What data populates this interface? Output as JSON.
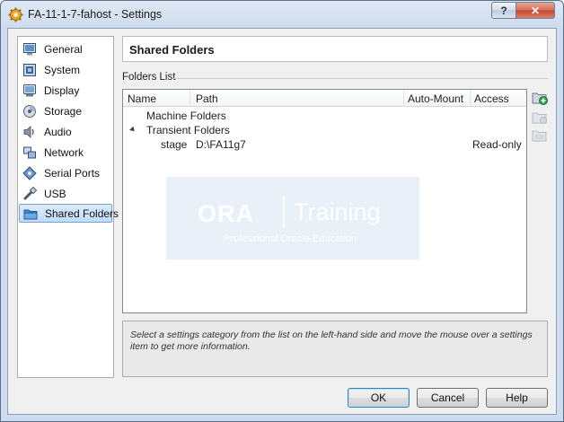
{
  "window": {
    "title": "FA-11-1-7-fahost - Settings",
    "help_label": "?",
    "close_label": "✕"
  },
  "sidebar": {
    "items": [
      {
        "label": "General",
        "icon": "general-icon"
      },
      {
        "label": "System",
        "icon": "system-icon"
      },
      {
        "label": "Display",
        "icon": "display-icon"
      },
      {
        "label": "Storage",
        "icon": "storage-icon"
      },
      {
        "label": "Audio",
        "icon": "audio-icon"
      },
      {
        "label": "Network",
        "icon": "network-icon"
      },
      {
        "label": "Serial Ports",
        "icon": "serial-ports-icon"
      },
      {
        "label": "USB",
        "icon": "usb-icon"
      },
      {
        "label": "Shared Folders",
        "icon": "shared-folders-icon",
        "selected": true
      }
    ]
  },
  "page": {
    "title": "Shared Folders",
    "group_label": "Folders List"
  },
  "folders_table": {
    "columns": [
      "Name",
      "Path",
      "Auto-Mount",
      "Access"
    ],
    "groups": [
      {
        "name": "Machine Folders",
        "rows": []
      },
      {
        "name": "Transient Folders",
        "rows": [
          {
            "name": "stage",
            "path": "D:\\FA11g7",
            "auto_mount": "",
            "access": "Read-only"
          }
        ]
      }
    ]
  },
  "watermark": {
    "logo": "ORA",
    "name": "Training",
    "tagline": "Professional Oracle Education"
  },
  "toolbar": {
    "add_icon": "add-folder-icon",
    "edit_icon": "edit-folder-icon",
    "remove_icon": "remove-folder-icon"
  },
  "info": {
    "text": "Select a settings category from the list on the left-hand side and move the mouse over a settings item to get more information."
  },
  "buttons": {
    "ok": "OK",
    "cancel": "Cancel",
    "help": "Help"
  },
  "colors": {
    "selection": "#c1dcfc",
    "title_bar": "#cfdced",
    "close_button": "#c7432a"
  }
}
